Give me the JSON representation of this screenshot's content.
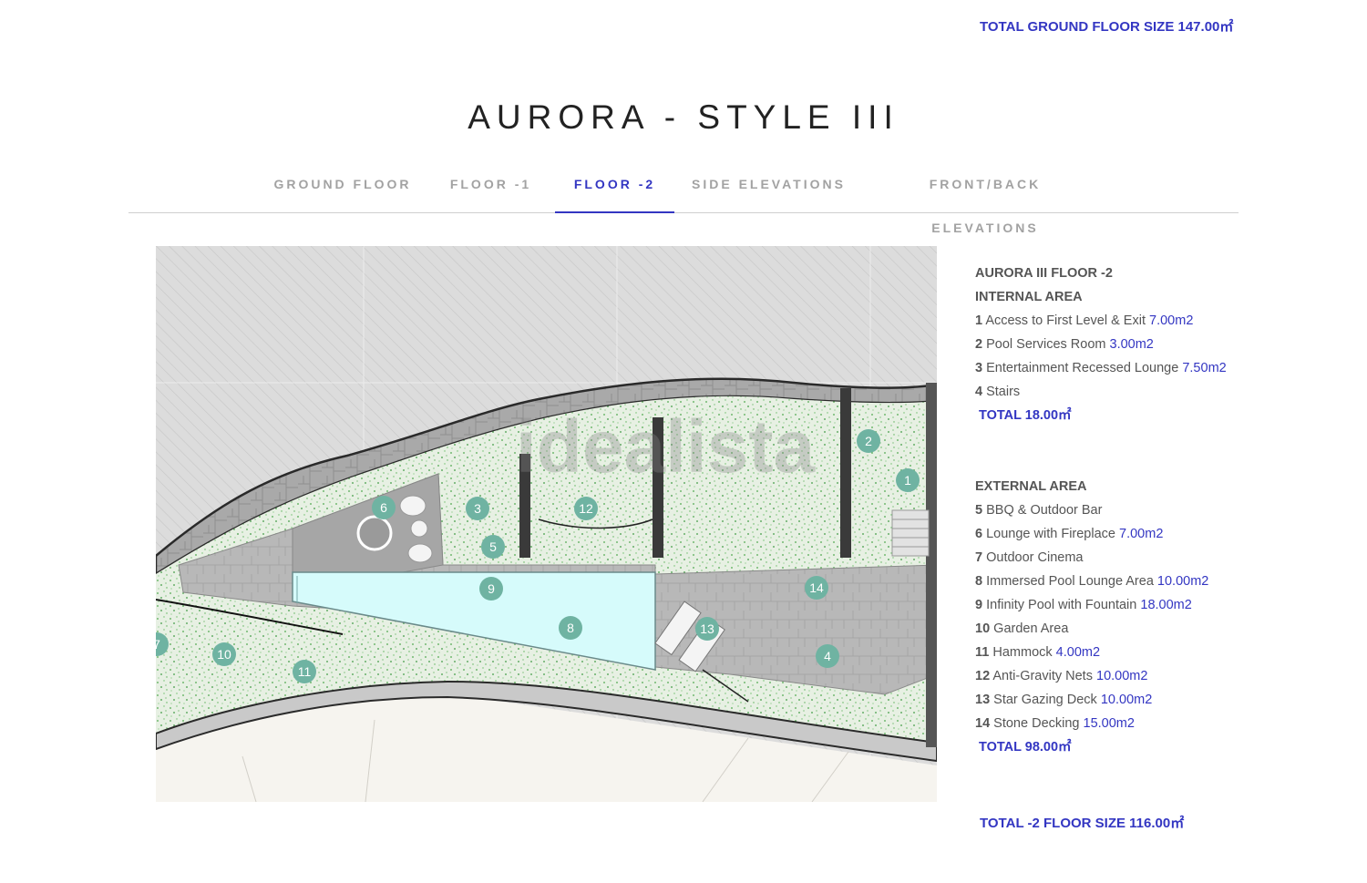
{
  "header": {
    "ground_floor_total": "TOTAL GROUND FLOOR SIZE 147.00㎡",
    "title": "AURORA - STYLE III"
  },
  "tabs": [
    {
      "label": "GROUND FLOOR",
      "active": false
    },
    {
      "label": "FLOOR -1",
      "active": false
    },
    {
      "label": "FLOOR -2",
      "active": true
    },
    {
      "label": "SIDE ELEVATIONS",
      "active": false
    },
    {
      "label": "FRONT/BACK ELEVATIONS",
      "active": false
    }
  ],
  "plan": {
    "watermark": "idealista",
    "markers": [
      "1",
      "2",
      "3",
      "4",
      "5",
      "6",
      "7",
      "8",
      "9",
      "10",
      "11",
      "12",
      "13",
      "14"
    ]
  },
  "info": {
    "title": "AURORA III FLOOR -2",
    "internal_heading": "INTERNAL AREA",
    "internal_items": [
      {
        "num": "1",
        "name": "Access to First Level & Exit",
        "area": "7.00m2"
      },
      {
        "num": "2",
        "name": "Pool Services Room",
        "area": "3.00m2"
      },
      {
        "num": "3",
        "name": "Entertainment Recessed Lounge",
        "area": "7.50m2"
      },
      {
        "num": "4",
        "name": "Stairs",
        "area": ""
      }
    ],
    "internal_total": "TOTAL 18.00㎡",
    "external_heading": "EXTERNAL AREA",
    "external_items": [
      {
        "num": "5",
        "name": "BBQ & Outdoor Bar",
        "area": ""
      },
      {
        "num": "6",
        "name": "Lounge with Fireplace",
        "area": "7.00m2"
      },
      {
        "num": "7",
        "name": "Outdoor Cinema",
        "area": ""
      },
      {
        "num": "8",
        "name": "Immersed Pool Lounge Area",
        "area": "10.00m2"
      },
      {
        "num": "9",
        "name": "Infinity Pool with Fountain",
        "area": "18.00m2"
      },
      {
        "num": "10",
        "name": "Garden Area",
        "area": ""
      },
      {
        "num": "11",
        "name": "Hammock",
        "area": "4.00m2"
      },
      {
        "num": "12",
        "name": "Anti-Gravity Nets",
        "area": "10.00m2"
      },
      {
        "num": "13",
        "name": "Star Gazing Deck",
        "area": "10.00m2"
      },
      {
        "num": "14",
        "name": "Stone Decking",
        "area": "15.00m2"
      }
    ],
    "external_total": "TOTAL 98.00㎡"
  },
  "footer": {
    "floor_total": "TOTAL -2 FLOOR SIZE 116.00㎡"
  },
  "colors": {
    "accent": "#3336c2",
    "marker": "#6fb3a2",
    "pool": "#d6fbfb",
    "garden": "#e6f0e2"
  }
}
